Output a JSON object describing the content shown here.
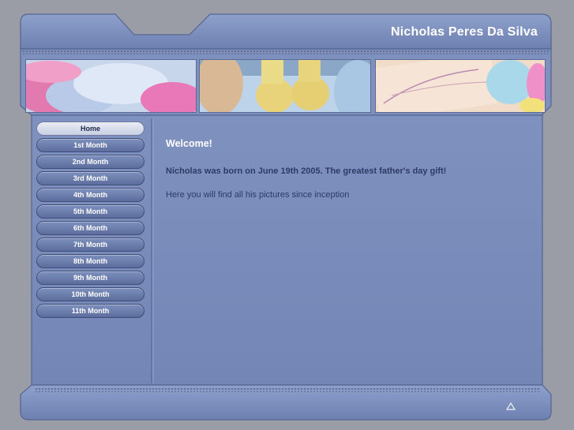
{
  "header": {
    "title": "Nicholas Peres Da Silva"
  },
  "sidebar": {
    "items": [
      {
        "label": "Home",
        "active": true
      },
      {
        "label": "1st Month"
      },
      {
        "label": "2nd Month"
      },
      {
        "label": "3rd Month"
      },
      {
        "label": "4th Month"
      },
      {
        "label": "5th Month"
      },
      {
        "label": "6th Month"
      },
      {
        "label": "7th Month"
      },
      {
        "label": "8th Month"
      },
      {
        "label": "9th Month"
      },
      {
        "label": "10th Month"
      },
      {
        "label": "11th Month"
      }
    ]
  },
  "main": {
    "welcome": "Welcome!",
    "intro": "Nicholas was born on June 19th 2005. The greatest father's day gift!",
    "description": "Here you will find all his pictures since inception"
  },
  "footer": {
    "scroll_top_icon": "triangle-up-icon"
  },
  "colors": {
    "page_background": "#9a9da6",
    "frame": "#7c8fbc",
    "frame_dark": "#5b6a94",
    "text_dark": "#2e3a66"
  }
}
